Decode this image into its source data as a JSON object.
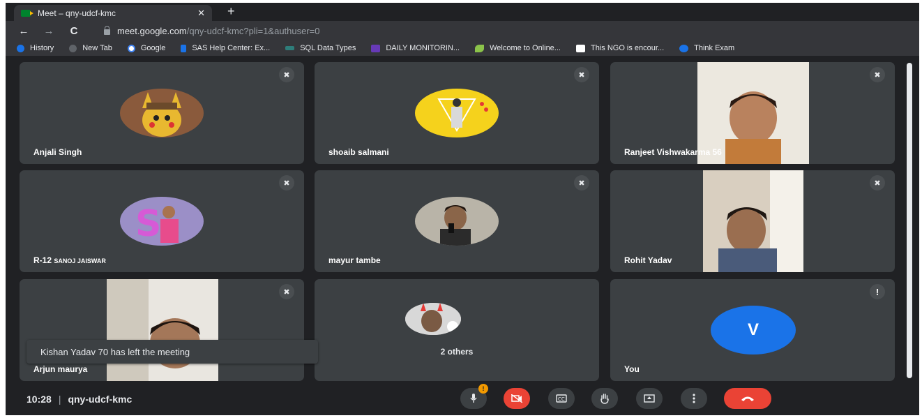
{
  "browser": {
    "tab_title": "Meet – qny-udcf-kmc",
    "tab_close": "✕",
    "new_tab": "+",
    "url_host": "meet.google.com",
    "url_path": "/qny-udcf-kmc?pli=1&authuser=0",
    "nav": {
      "back": "←",
      "forward": "→",
      "reload": "C"
    }
  },
  "bookmarks": [
    {
      "label": "History",
      "color": "#1a73e8"
    },
    {
      "label": "New Tab",
      "color": "#9aa0a6"
    },
    {
      "label": "Google",
      "color": "#ffffff"
    },
    {
      "label": "SAS Help Center: Ex...",
      "color": "#1a73e8"
    },
    {
      "label": "SQL Data Types",
      "color": "#2e7d7a"
    },
    {
      "label": "DAILY MONITORIN...",
      "color": "#673ab7"
    },
    {
      "label": "Welcome to Online...",
      "color": "#8bc34a"
    },
    {
      "label": "This NGO is encour...",
      "color": "#ffffff"
    },
    {
      "label": "Think Exam",
      "color": "#1a73e8"
    }
  ],
  "participants": [
    {
      "name": "Anjali Singh",
      "muted_icon": "mic-off-icon"
    },
    {
      "name": "shoaib salmani",
      "muted_icon": "mic-off-icon"
    },
    {
      "name": "Ranjeet Vishwakarma 56",
      "muted_icon": "mic-off-icon"
    },
    {
      "name_prefix": "R-12",
      "name_rest": "SANOJ JAISWAR",
      "muted_icon": "mic-off-icon"
    },
    {
      "name": "mayur tambe",
      "muted_icon": "mic-off-icon"
    },
    {
      "name": "Rohit Yadav",
      "muted_icon": "mic-off-icon"
    },
    {
      "name": "Arjun maurya",
      "muted_icon": "mic-off-icon"
    }
  ],
  "others_label": "2 others",
  "self": {
    "initial": "V",
    "name": "You",
    "alert": "!"
  },
  "toast": "Kishan Yadav 70 has left the meeting",
  "meeting": {
    "time": "10:28",
    "separator": "|",
    "code": "qny-udcf-kmc"
  },
  "controls": {
    "mic_badge": "!",
    "buttons": [
      "mic-icon",
      "camera-off-icon",
      "captions-icon",
      "raise-hand-icon",
      "present-icon",
      "more-options-icon",
      "hang-up-icon"
    ]
  },
  "colors": {
    "background": "#202124",
    "tile": "#3c4043",
    "danger": "#ea4335",
    "avatar_blue": "#1a73e8"
  }
}
